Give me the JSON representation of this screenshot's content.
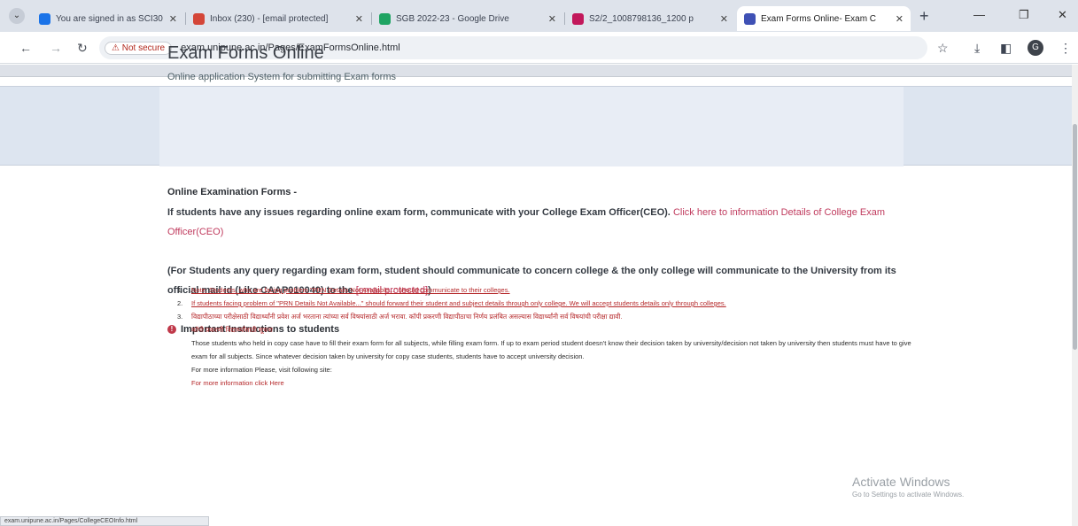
{
  "browser": {
    "tabs": [
      {
        "title": "You are signed in as SCI30",
        "fav_color": "#1a73e8",
        "active": false
      },
      {
        "title": "Inbox (230) - [email protected]",
        "fav_color": "#d44638",
        "active": false
      },
      {
        "title": "SGB 2022-23 - Google Drive",
        "fav_color": "#1fa463",
        "active": false
      },
      {
        "title": "S2/2_1008798136_1200 p",
        "fav_color": "#c2185b",
        "active": false
      },
      {
        "title": "Exam Forms Online- Exam C",
        "fav_color": "#3f51b5",
        "active": true
      }
    ],
    "new_tab": "+",
    "security_label": "Not secure",
    "url": "exam.unipune.ac.in/Pages/ExamFormsOnline.html",
    "profile_initial": "G",
    "status_url": "exam.unipune.ac.in/Pages/CollegeCEOInfo.html"
  },
  "page": {
    "title": "Exam Forms Online",
    "subtitle": "Online application System for submitting Exam forms",
    "section_title": "Online Examination Forms -",
    "notice_lead": "If students have any issues regarding online exam form, communicate with your College Exam Officer(CEO).",
    "notice_link": "Click here to information Details of College Exam Officer(CEO)",
    "query_text": "(For Students any query regarding exam form, student should communicate to concern college & the only college will communicate to the University from its official mail id (Like CAAP010040) to the",
    "query_email": "[email protected]",
    "query_tail": ")",
    "important_heading": "Important Instructions to students",
    "instructions": [
      {
        "num": "1.",
        "text": "Note: Students, who are facing problem \"PRN Details Not Available...\" should communicate to their colleges."
      },
      {
        "num": "2.",
        "text": "If students facing problem of \"PRN Details Not Available...\" should forward their student and subject details through only college. We will accept students details only through colleges."
      },
      {
        "num": "3.",
        "text": "विद्यापीठाच्या परीक्षेसाठी विद्यार्थ्यांनी प्रवेश अर्ज भरताना त्यांच्या सर्व विषयांसाठी अर्ज भरावा. कॉपी प्रकरणी विद्यापीठाचा निर्णय प्रलंबित असल्यास विद्यार्थ्यांनी सर्व विषयांची परीक्षा द्यावी."
      }
    ],
    "instr_red_line": "कॉपी प्रकरणी विद्यार्थ्यांसाठी सूचना",
    "instr_paragraph": "Those students who held in copy case have to fill their exam form for all subjects, while filling exam form. If up to exam period student doesn't know their decision taken by university/decision not taken by university then students must have to give exam for all subjects. Since whatever decision taken by university for copy case students, students have to accept university decision.",
    "instr_visit": "For more information Please, visit following site:",
    "instr_link": "For more information click Here"
  },
  "watermark": {
    "line1": "Activate Windows",
    "line2": "Go to Settings to activate Windows."
  }
}
